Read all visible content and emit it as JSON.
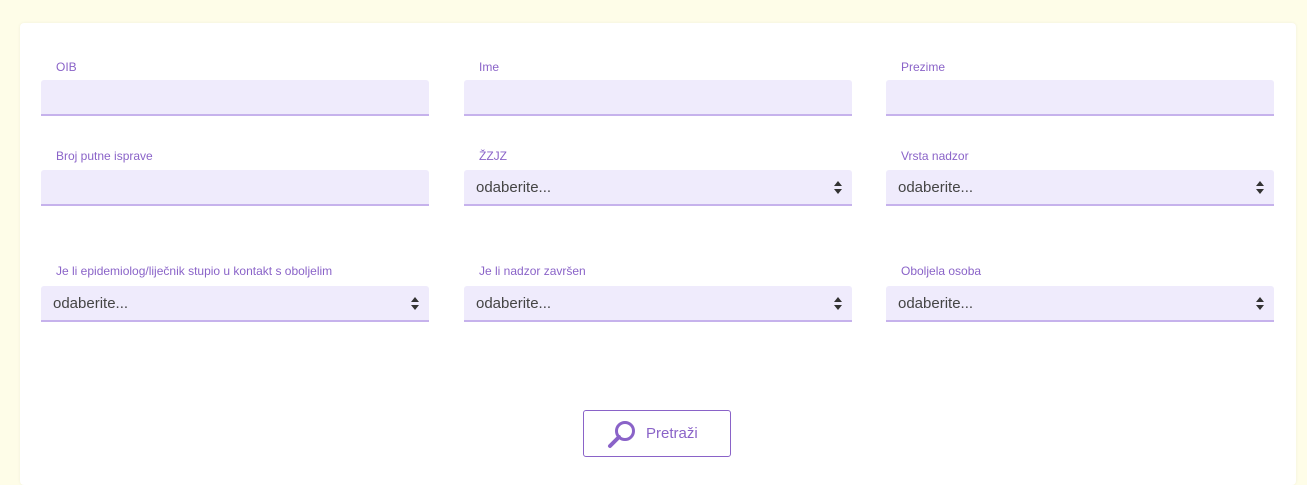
{
  "colors": {
    "page_background": "#fefde8",
    "card_background": "#ffffff",
    "accent": "#8a63c8",
    "field_background": "#efebfc",
    "field_underline": "#c6b2ec"
  },
  "form": {
    "oib": {
      "label": "OIB",
      "value": ""
    },
    "ime": {
      "label": "Ime",
      "value": ""
    },
    "prezime": {
      "label": "Prezime",
      "value": ""
    },
    "broj_putne_isprave": {
      "label": "Broj putne isprave",
      "value": ""
    },
    "zzjz": {
      "label": "ŽZJZ",
      "selected": "odaberite..."
    },
    "vrsta_nadzor": {
      "label": "Vrsta nadzor",
      "selected": "odaberite..."
    },
    "kontakt": {
      "label": "Je li epidemiolog/liječnik stupio u kontakt s oboljelim",
      "selected": "odaberite..."
    },
    "nadzor_zavrsen": {
      "label": "Je li nadzor završen",
      "selected": "odaberite..."
    },
    "oboljela_osoba": {
      "label": "Oboljela osoba",
      "selected": "odaberite..."
    }
  },
  "actions": {
    "search_label": "Pretraži",
    "search_icon": "magnifier-icon"
  }
}
